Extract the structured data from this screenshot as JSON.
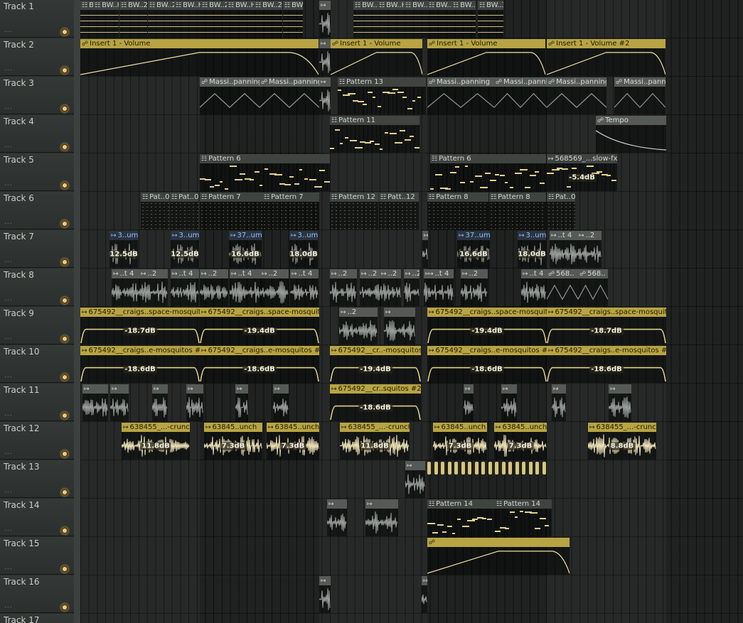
{
  "tracks": [
    {
      "name": "Track 1"
    },
    {
      "name": "Track 2"
    },
    {
      "name": "Track 3"
    },
    {
      "name": "Track 4"
    },
    {
      "name": "Track 5"
    },
    {
      "name": "Track 6"
    },
    {
      "name": "Track 7"
    },
    {
      "name": "Track 8"
    },
    {
      "name": "Track 9"
    },
    {
      "name": "Track 10"
    },
    {
      "name": "Track 11"
    },
    {
      "name": "Track 12"
    },
    {
      "name": "Track 13"
    },
    {
      "name": "Track 14"
    },
    {
      "name": "Track 15"
    },
    {
      "name": "Track 16"
    },
    {
      "name": "Track 17"
    }
  ],
  "track_dots_label": "...",
  "colors": {
    "automation": "#b8a443",
    "pattern_header": "#3f4441",
    "note": "#e4d18f",
    "enabled": "#f1c77b"
  },
  "clips": [
    {
      "track": 0,
      "kind": "pat",
      "label": "B..H",
      "icon": "pattern-icon"
    },
    {
      "track": 0,
      "kind": "pat",
      "label": "BW..H",
      "icon": "pattern-icon"
    },
    {
      "track": 0,
      "kind": "pat",
      "label": "BW..2",
      "icon": "pattern-icon"
    },
    {
      "track": 0,
      "kind": "pat",
      "label": "BW..2",
      "icon": "pattern-icon"
    },
    {
      "track": 0,
      "kind": "pat",
      "label": "BW..H",
      "icon": "pattern-icon"
    },
    {
      "track": 0,
      "kind": "pat",
      "label": "BW..2",
      "icon": "pattern-icon"
    },
    {
      "track": 0,
      "kind": "pat",
      "label": "BW..H",
      "icon": "pattern-icon"
    },
    {
      "track": 0,
      "kind": "pat",
      "label": "BW..2",
      "icon": "pattern-icon"
    },
    {
      "track": 0,
      "kind": "pat",
      "label": "BW..H",
      "icon": "pattern-icon"
    },
    {
      "track": 0,
      "kind": "pat",
      "label": "BW..2",
      "icon": "pattern-icon"
    },
    {
      "track": 0,
      "kind": "pat",
      "label": "BW..H",
      "icon": "pattern-icon"
    },
    {
      "track": 0,
      "kind": "pat",
      "label": "BW..3",
      "icon": "pattern-icon"
    },
    {
      "track": 0,
      "kind": "pat",
      "label": "BW..3",
      "icon": "pattern-icon"
    },
    {
      "track": 0,
      "kind": "pat",
      "label": "BW..3",
      "icon": "pattern-icon"
    },
    {
      "track": 0,
      "kind": "pat",
      "label": "BW..3",
      "icon": "pattern-icon"
    },
    {
      "track": 1,
      "kind": "aut",
      "label": "Insert 1 - Volume",
      "icon": "automation-icon"
    },
    {
      "track": 1,
      "kind": "aut",
      "label": "Insert 1 - Volume",
      "icon": "automation-icon"
    },
    {
      "track": 1,
      "kind": "aut",
      "label": "Insert 1 - Volume",
      "icon": "automation-icon"
    },
    {
      "track": 1,
      "kind": "aut",
      "label": "Insert 1 - Volume #2",
      "icon": "automation-icon"
    },
    {
      "track": 2,
      "kind": "smp",
      "label": "Massi..panning",
      "icon": "automation-icon"
    },
    {
      "track": 2,
      "kind": "smp",
      "label": "Massi..panning",
      "icon": "automation-icon"
    },
    {
      "track": 2,
      "kind": "pat",
      "label": "Pattern 13",
      "icon": "pattern-icon"
    },
    {
      "track": 2,
      "kind": "smp",
      "label": "Massi..panning",
      "icon": "automation-icon"
    },
    {
      "track": 2,
      "kind": "smp",
      "label": "Massi..panning",
      "icon": "automation-icon"
    },
    {
      "track": 2,
      "kind": "smp",
      "label": "Massi..panning",
      "icon": "automation-icon"
    },
    {
      "track": 2,
      "kind": "smp",
      "label": "Massi..panning",
      "icon": "automation-icon"
    },
    {
      "track": 3,
      "kind": "pat",
      "label": "Pattern 11",
      "icon": "pattern-icon"
    },
    {
      "track": 3,
      "kind": "smp",
      "label": "Tempo",
      "icon": "automation-icon"
    },
    {
      "track": 4,
      "kind": "pat",
      "label": "Pattern 6",
      "icon": "pattern-icon"
    },
    {
      "track": 4,
      "kind": "pat",
      "label": "Pattern 6",
      "icon": "pattern-icon"
    },
    {
      "track": 4,
      "kind": "pat",
      "label": "568569_...slow-fx",
      "icon": "audio-icon",
      "gain": "-5.4dB"
    },
    {
      "track": 5,
      "kind": "pat",
      "label": "Pat..0",
      "icon": "pattern-icon"
    },
    {
      "track": 5,
      "kind": "pat",
      "label": "Pat..0",
      "icon": "pattern-icon"
    },
    {
      "track": 5,
      "kind": "pat",
      "label": "Pattern 7",
      "icon": "pattern-icon"
    },
    {
      "track": 5,
      "kind": "pat",
      "label": "Pattern 7",
      "icon": "pattern-icon"
    },
    {
      "track": 5,
      "kind": "pat",
      "label": "Pattern 12",
      "icon": "pattern-icon"
    },
    {
      "track": 5,
      "kind": "pat",
      "label": "Patt..12",
      "icon": "pattern-icon"
    },
    {
      "track": 5,
      "kind": "pat",
      "label": "Pattern 8",
      "icon": "pattern-icon"
    },
    {
      "track": 5,
      "kind": "pat",
      "label": "Pattern 8",
      "icon": "pattern-icon"
    },
    {
      "track": 5,
      "kind": "pat",
      "label": "Pat..0",
      "icon": "pattern-icon"
    },
    {
      "track": 6,
      "kind": "blu",
      "label": "3..um",
      "icon": "audio-icon",
      "gain": "12.5dB"
    },
    {
      "track": 6,
      "kind": "blu",
      "label": "3..um",
      "icon": "audio-icon",
      "gain": "12.5dB"
    },
    {
      "track": 6,
      "kind": "blu",
      "label": "37..um",
      "icon": "audio-icon",
      "gain": "16.6dB"
    },
    {
      "track": 6,
      "kind": "blu",
      "label": "3..um",
      "icon": "audio-icon",
      "gain": "18.0dB"
    },
    {
      "track": 6,
      "kind": "blu",
      "label": "37..um",
      "icon": "audio-icon",
      "gain": "16.6dB"
    },
    {
      "track": 6,
      "kind": "blu",
      "label": "3..um",
      "icon": "audio-icon",
      "gain": "18.0dB"
    },
    {
      "track": 6,
      "kind": "smp",
      "label": "..t 4",
      "icon": "audio-icon"
    },
    {
      "track": 6,
      "kind": "smp",
      "label": "..2",
      "icon": "audio-icon"
    },
    {
      "track": 7,
      "kind": "smp",
      "label": "..t 4",
      "icon": "audio-icon"
    },
    {
      "track": 7,
      "kind": "smp",
      "label": "..2",
      "icon": "audio-icon"
    },
    {
      "track": 7,
      "kind": "smp",
      "label": "..t 4",
      "icon": "audio-icon"
    },
    {
      "track": 7,
      "kind": "smp",
      "label": "..2",
      "icon": "audio-icon"
    },
    {
      "track": 7,
      "kind": "smp",
      "label": "..t 4",
      "icon": "audio-icon"
    },
    {
      "track": 7,
      "kind": "smp",
      "label": "..2",
      "icon": "audio-icon"
    },
    {
      "track": 7,
      "kind": "smp",
      "label": "..t 4",
      "icon": "audio-icon"
    },
    {
      "track": 7,
      "kind": "smp",
      "label": "..2",
      "icon": "audio-icon"
    },
    {
      "track": 7,
      "kind": "smp",
      "label": "..2",
      "icon": "audio-icon"
    },
    {
      "track": 7,
      "kind": "smp",
      "label": "..2",
      "icon": "audio-icon"
    },
    {
      "track": 7,
      "kind": "smp",
      "label": "..2",
      "icon": "audio-icon"
    },
    {
      "track": 7,
      "kind": "smp",
      "label": "..t 4",
      "icon": "audio-icon"
    },
    {
      "track": 7,
      "kind": "smp",
      "label": "..2",
      "icon": "audio-icon"
    },
    {
      "track": 7,
      "kind": "smp",
      "label": "..t 4",
      "icon": "audio-icon"
    },
    {
      "track": 7,
      "kind": "smp",
      "label": "568..",
      "icon": "automation-icon"
    },
    {
      "track": 7,
      "kind": "smp",
      "label": "568..",
      "icon": "automation-icon"
    },
    {
      "track": 8,
      "kind": "aud",
      "label": "675492__craigs..space-mosquitos",
      "icon": "audio-icon",
      "gain": "-18.7dB"
    },
    {
      "track": 8,
      "kind": "aud",
      "label": "675492__craigs..space-mosquitos",
      "icon": "audio-icon",
      "gain": "-19.4dB"
    },
    {
      "track": 8,
      "kind": "smp",
      "label": "..2",
      "icon": "audio-icon"
    },
    {
      "track": 8,
      "kind": "smp",
      "label": "",
      "icon": "audio-icon"
    },
    {
      "track": 8,
      "kind": "aud",
      "label": "675492__craigs..space-mosquitos",
      "icon": "audio-icon",
      "gain": "-19.4dB"
    },
    {
      "track": 8,
      "kind": "aud",
      "label": "675492__craigs..space-mosquitos",
      "icon": "audio-icon",
      "gain": "-18.7dB"
    },
    {
      "track": 9,
      "kind": "aud",
      "label": "675492__craigs..e-mosquitos #2",
      "icon": "audio-icon",
      "gain": "-18.6dB"
    },
    {
      "track": 9,
      "kind": "aud",
      "label": "675492__craigs..e-mosquitos #2",
      "icon": "audio-icon",
      "gain": "-18.6dB"
    },
    {
      "track": 9,
      "kind": "aud",
      "label": "675492__cr..-mosquitos",
      "icon": "audio-icon",
      "gain": "-19.4dB"
    },
    {
      "track": 9,
      "kind": "aud",
      "label": "675492__craigs..e-mosquitos #2",
      "icon": "audio-icon",
      "gain": "-18.6dB"
    },
    {
      "track": 9,
      "kind": "aud",
      "label": "675492__craigs..e-mosquitos #2",
      "icon": "audio-icon",
      "gain": "-18.6dB"
    },
    {
      "track": 10,
      "kind": "aud",
      "label": "675492__cr..squitos #2",
      "icon": "audio-icon",
      "gain": "-18.6dB"
    },
    {
      "track": 11,
      "kind": "aud",
      "label": "638455_...-crunch",
      "icon": "audio-icon",
      "gain": "11.8dB"
    },
    {
      "track": 11,
      "kind": "aud",
      "label": "63845..unch",
      "icon": "audio-icon",
      "gain": "7.3dB"
    },
    {
      "track": 11,
      "kind": "aud",
      "label": "63845..unch",
      "icon": "audio-icon",
      "gain": "7.3dB"
    },
    {
      "track": 11,
      "kind": "aud",
      "label": "638455_...-crunch",
      "icon": "audio-icon",
      "gain": "11.8dB"
    },
    {
      "track": 11,
      "kind": "aud",
      "label": "63845..unch",
      "icon": "audio-icon",
      "gain": "7.3dB"
    },
    {
      "track": 11,
      "kind": "aud",
      "label": "63845..unch",
      "icon": "audio-icon",
      "gain": "7.3dB"
    },
    {
      "track": 11,
      "kind": "aud",
      "label": "638455_...-crunch",
      "icon": "audio-icon",
      "gain": "8.8dB"
    },
    {
      "track": 13,
      "kind": "pat",
      "label": "Pattern 14",
      "icon": "pattern-icon"
    },
    {
      "track": 13,
      "kind": "pat",
      "label": "Pattern 14",
      "icon": "pattern-icon"
    }
  ]
}
